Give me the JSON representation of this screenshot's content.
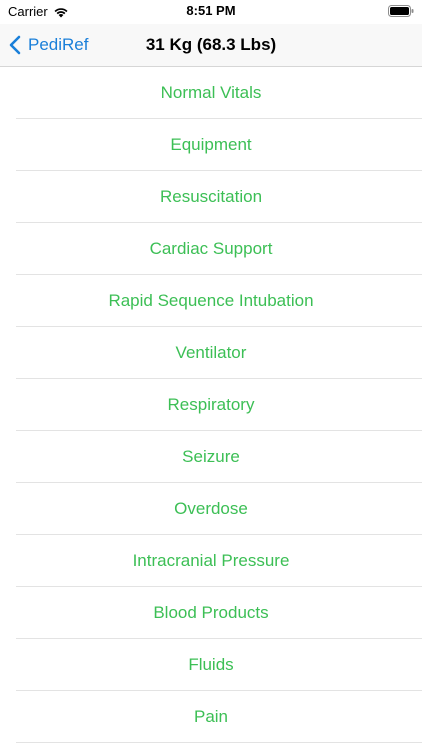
{
  "status_bar": {
    "carrier": "Carrier",
    "time": "8:51 PM",
    "icons": [
      "wifi-icon",
      "battery-icon"
    ]
  },
  "nav": {
    "back_label": "PediRef",
    "title": "31 Kg (68.3 Lbs)",
    "back_icon": "chevron-left-icon",
    "accent_color": "#1a7fd9"
  },
  "menu": {
    "text_color": "#3cbf55",
    "items": [
      "Normal Vitals",
      "Equipment",
      "Resuscitation",
      "Cardiac Support",
      "Rapid Sequence Intubation",
      "Ventilator",
      "Respiratory",
      "Seizure",
      "Overdose",
      "Intracranial Pressure",
      "Blood Products",
      "Fluids",
      "Pain"
    ]
  }
}
